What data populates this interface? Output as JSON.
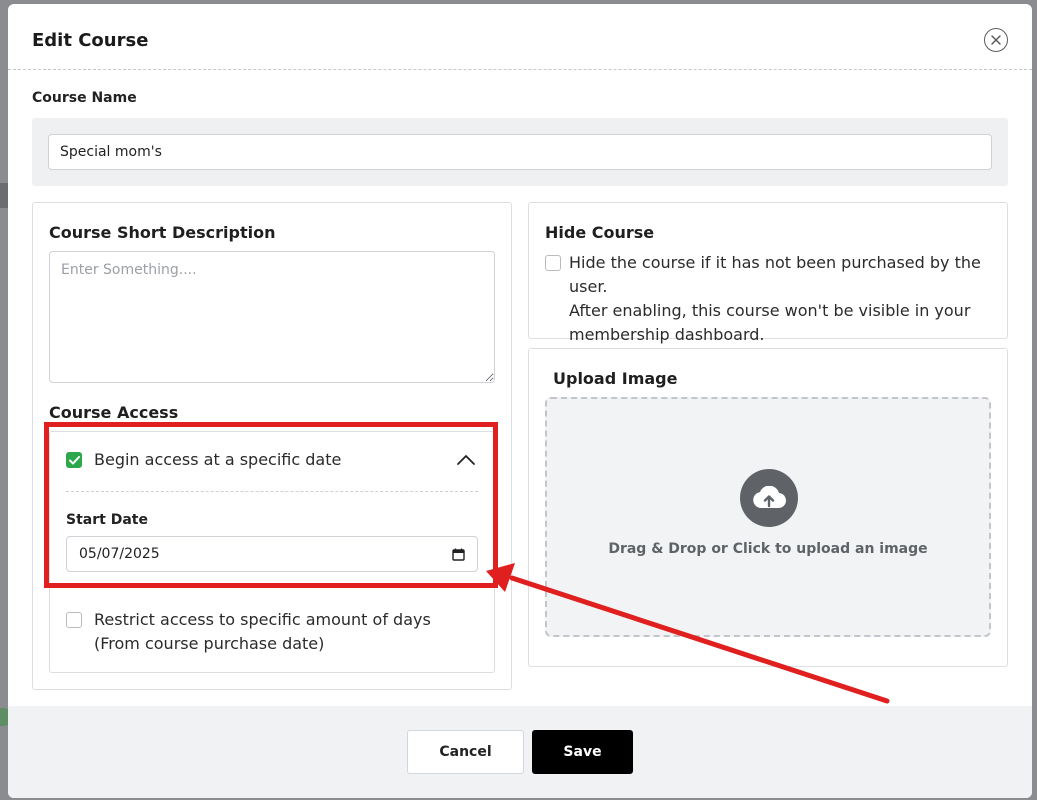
{
  "dialog": {
    "title": "Edit Course",
    "close_icon": "close-circle-icon"
  },
  "course_name": {
    "label": "Course Name",
    "value": "Special mom's"
  },
  "short_description": {
    "title": "Course Short Description",
    "placeholder": "Enter Something...."
  },
  "course_access": {
    "title": "Course Access",
    "begin_access": {
      "label": "Begin access at a specific date",
      "checked": true,
      "expanded": true
    },
    "start_date": {
      "label": "Start Date",
      "value": "05/07/2025",
      "icon": "calendar-icon"
    },
    "restrict_access": {
      "line1": "Restrict access to specific amount of days",
      "line2": "(From course purchase date)",
      "checked": false
    }
  },
  "hide_course": {
    "title": "Hide Course",
    "checked": false,
    "line1": "Hide the course if it has not been purchased by the user.",
    "line2": "After enabling, this course won't be visible in your",
    "line3": "membership dashboard."
  },
  "upload_image": {
    "title": "Upload Image",
    "icon": "cloud-upload-icon",
    "instruction": "Drag & Drop or Click to upload an image"
  },
  "footer": {
    "cancel_label": "Cancel",
    "save_label": "Save"
  },
  "colors": {
    "accent_green": "#2aa84a",
    "annotation_red": "#e0201f",
    "save_button": "#000000"
  }
}
